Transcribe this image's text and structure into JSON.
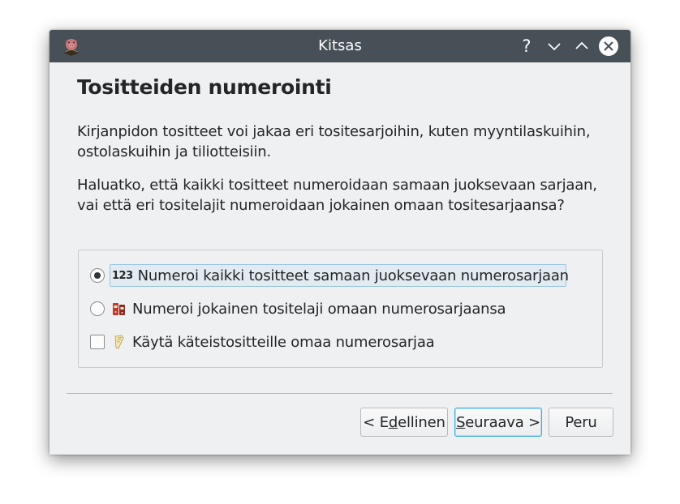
{
  "window": {
    "title": "Kitsas",
    "app_icon": "kitsas-pig-icon",
    "buttons": {
      "help": "?",
      "minimize": "chevron-down-icon",
      "maximize": "chevron-up-icon",
      "close": "close-icon"
    }
  },
  "page": {
    "title": "Tositteiden numerointi",
    "paragraph1": "Kirjanpidon tositteet voi jakaa eri tositesarjoihin, kuten myyntilaskuihin, ostolaskuihin ja tiliotteisiin.",
    "paragraph2": "Haluatko, että kaikki tositteet numeroidaan samaan juoksevaan sarjaan, vai että eri tositelajit numeroidaan jokainen omaan tositesarjaansa?"
  },
  "options": [
    {
      "type": "radio",
      "checked": true,
      "icon": "123",
      "label": "Numeroi kaikki tositteet samaan juoksevaan numerosarjaan"
    },
    {
      "type": "radio",
      "checked": false,
      "icon": "binders-icon",
      "label": "Numeroi jokainen tositelaji omaan numerosarjaansa"
    },
    {
      "type": "checkbox",
      "checked": false,
      "icon": "receipt-icon",
      "label": "Käytä käteistositteille omaa numerosarjaa"
    }
  ],
  "footer": {
    "prev_prefix": "< E",
    "prev_mnemonic": "d",
    "prev_suffix": "ellinen",
    "next_mnemonic": "S",
    "next_suffix": "euraava >",
    "cancel_label": "Peru"
  },
  "colors": {
    "titlebar": "#475057",
    "background": "#eff0f1",
    "focus_accent": "#3daee9"
  }
}
